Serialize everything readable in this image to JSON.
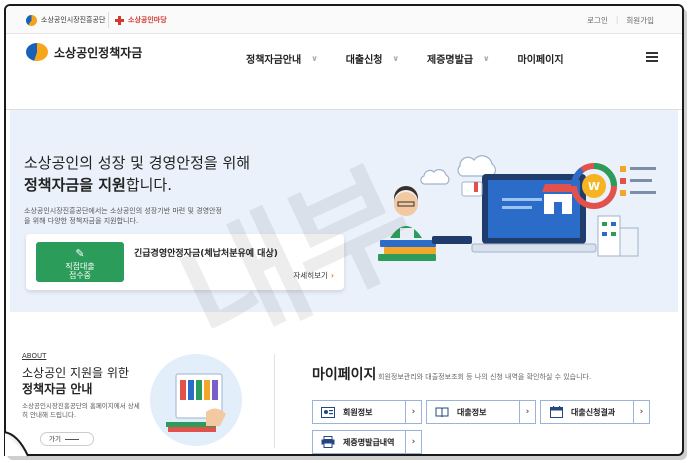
{
  "util": {
    "partner1": "소상공인시장진흥공단",
    "partner2": "소상공인마당",
    "login": "로그인",
    "signup": "회원가입"
  },
  "header": {
    "brand": "소상공인정책자금",
    "nav": [
      "정책자금안내",
      "대출신청",
      "제증명발급",
      "마이페이지"
    ],
    "nav_chevron": "∨",
    "menu_icon": "hamburger-icon"
  },
  "hero": {
    "line1": "소상공인의 성장 및 경영안정을 위해",
    "line2_bold": "정책자금을 지원",
    "line2_rest": "합니다.",
    "desc": "소상공인시장진흥공단에서는 소상공인의 성장기반 마련 및 경영안정을 위해 다양한 정책자금을 지원합니다.",
    "card": {
      "badge": "직접대출\n접수중",
      "title": "긴급경영안정자금(체납처분유예 대상)",
      "more": "자세히보기",
      "more_arrow": "›"
    }
  },
  "watermark": "내부",
  "about": {
    "label": "ABOUT",
    "title1": "소상공인 지원을 위한",
    "title2": "정책자금 안내",
    "desc": "소상공인시장진흥공단의 홈페이지에서 상세히 안내해 드립니다.",
    "go": "가기"
  },
  "mypage": {
    "title": "마이페이지",
    "desc": "회원정보관리와 대출정보조회 등 나의 신청 내역을 확인하실 수 있습니다.",
    "buttons": [
      {
        "label": "회원정보",
        "icon": "id-card-icon"
      },
      {
        "label": "대출정보",
        "icon": "book-icon"
      },
      {
        "label": "대출신청결과",
        "icon": "calendar-icon"
      },
      {
        "label": "제증명발급내역",
        "icon": "printer-icon"
      }
    ],
    "chevron": "›"
  },
  "colors": {
    "hero_bg": "#eaf1fb",
    "badge_green": "#2c9c5b",
    "accent_orange": "#e46a2c",
    "brand_blue": "#1b60b7",
    "brand_orange": "#f7a51b"
  }
}
